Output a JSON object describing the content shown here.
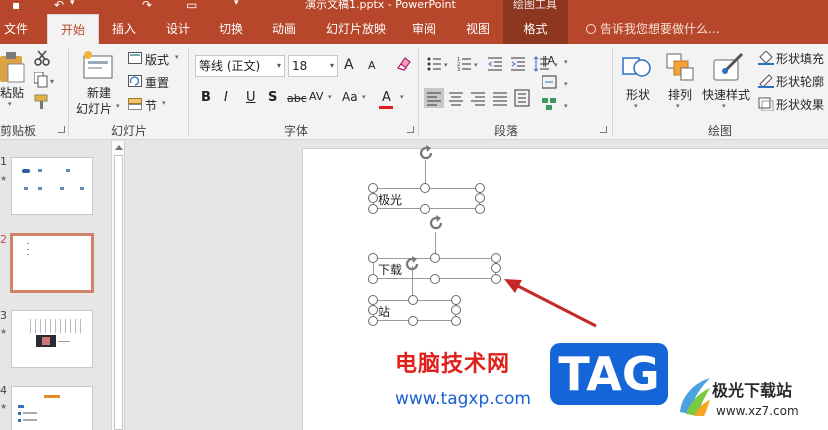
{
  "title_bar": {
    "document_title": "演示文稿1.pptx - PowerPoint",
    "context_group": "绘图工具"
  },
  "tabs": [
    {
      "label": "文件"
    },
    {
      "label": "开始"
    },
    {
      "label": "插入"
    },
    {
      "label": "设计"
    },
    {
      "label": "切换"
    },
    {
      "label": "动画"
    },
    {
      "label": "幻灯片放映"
    },
    {
      "label": "审阅"
    },
    {
      "label": "视图"
    },
    {
      "label": "格式"
    }
  ],
  "active_tab": "开始",
  "tell_me": "告诉我您想要做什么...",
  "ribbon": {
    "clipboard": {
      "paste": "粘贴",
      "group": "剪贴板"
    },
    "slides": {
      "new_slide_l1": "新建",
      "new_slide_l2": "幻灯片",
      "layout": "版式",
      "reset": "重置",
      "section": "节",
      "group": "幻灯片"
    },
    "font": {
      "font_name": "等线 (正文)",
      "font_size": "18",
      "bold": "B",
      "italic": "I",
      "underline": "U",
      "shadow": "S",
      "strike": "abc",
      "spacing": "AV",
      "case": "Aa",
      "color": "A",
      "grow": "A",
      "shrink": "A",
      "group": "字体"
    },
    "paragraph": {
      "group": "段落"
    },
    "drawing": {
      "shapes": "形状",
      "arrange": "排列",
      "quick_styles": "快速样式",
      "fill": "形状填充",
      "outline": "形状轮廓",
      "effects": "形状效果",
      "group": "绘图"
    }
  },
  "slides": [
    {
      "number": "1",
      "starred": true
    },
    {
      "number": "2",
      "starred": false,
      "selected": true
    },
    {
      "number": "3",
      "starred": true
    },
    {
      "number": "4",
      "starred": true
    }
  ],
  "canvas": {
    "textbox_1": "极光",
    "textbox_2": "下载",
    "textbox_3": "站"
  },
  "watermark": {
    "site_cn": "电脑技术网",
    "site_url": "www.tagxp.com",
    "tag_logo": "TAG",
    "brand_cn": "极光下载站",
    "brand_url": "www.xz7.com"
  },
  "colors": {
    "accent": "#b7472a",
    "arrow": "#c62828",
    "tag_blue": "#1565d8"
  }
}
